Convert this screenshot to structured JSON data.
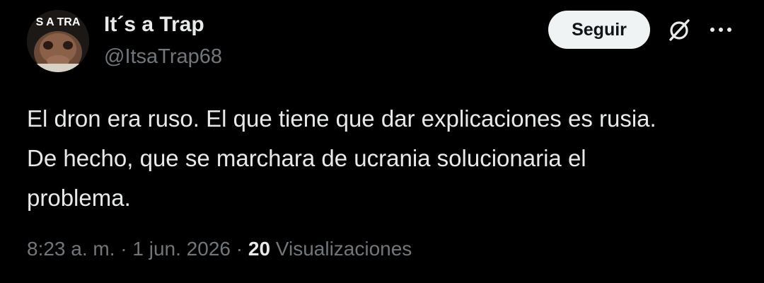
{
  "author": {
    "display_name": "It´s a Trap",
    "handle": "@ItsaTrap68",
    "avatar_text": "S A TRA"
  },
  "actions": {
    "follow_label": "Seguir",
    "grok_icon": "grok-slashed-circle-icon",
    "more_icon": "more-dots-icon"
  },
  "post": {
    "lines": [
      "El dron era ruso. El que tiene que dar explicaciones es rusia.",
      "De hecho, que se marchara de ucrania solucionaria el",
      "problema."
    ]
  },
  "meta": {
    "time": "8:23 a. m.",
    "sep1": " · ",
    "date": "1 jun. 2026",
    "sep2": " · ",
    "views_count": "20",
    "views_label": " Visualizaciones"
  },
  "colors": {
    "background": "#000000",
    "primary_text": "#e7e9ea",
    "secondary_text": "#71767b",
    "button_bg": "#eff3f4",
    "button_text": "#0f1419"
  }
}
